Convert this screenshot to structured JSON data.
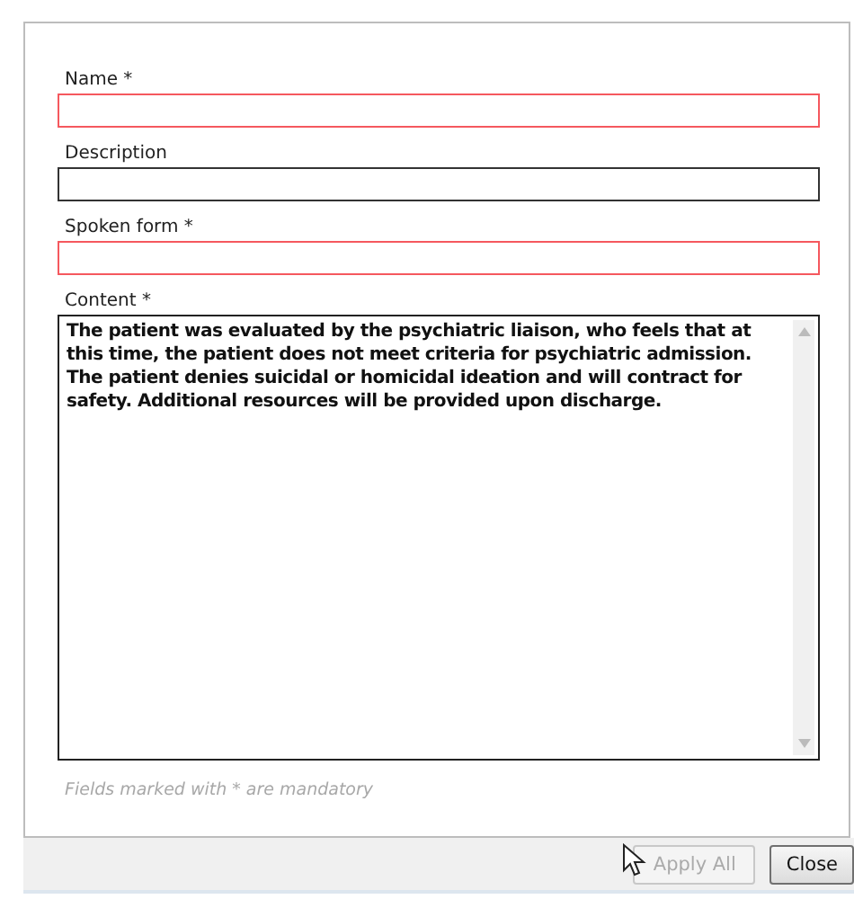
{
  "fields": [
    {
      "label": "Name *",
      "invalid": true
    },
    {
      "label": "Description",
      "invalid": false
    },
    {
      "label": "Spoken form *",
      "invalid": true
    }
  ],
  "content": {
    "label": "Content *",
    "value": "The patient was evaluated by the psychiatric liaison, who feels that at this time, the patient does not meet criteria for psychiatric admission. The patient denies suicidal or homicidal ideation and will contract for safety. Additional resources will be provided upon discharge.",
    "invalid": false
  },
  "note": "Fields marked with * are mandatory",
  "buttons": [
    {
      "label": "Apply All",
      "disabled": true
    },
    {
      "label": "Close",
      "disabled": false
    }
  ]
}
